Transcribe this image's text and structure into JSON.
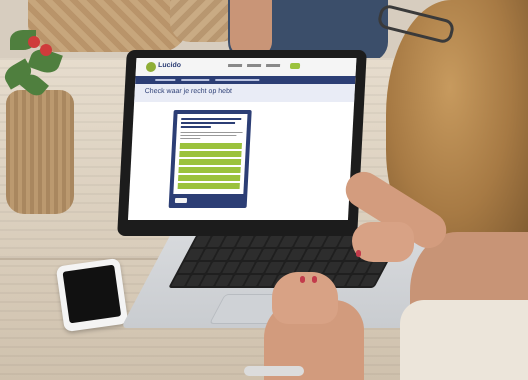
{
  "screen": {
    "logo_text": "Lucido",
    "page_title": "Check waar je recht op hebt"
  },
  "colors": {
    "site_navy": "#2c3e75",
    "site_green": "#9bc23c"
  }
}
